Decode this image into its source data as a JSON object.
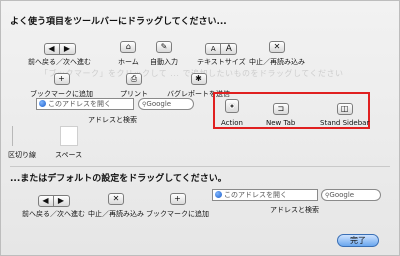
{
  "sheet": {
    "heading_top": "よく使う項目をツールバーにドラッグしてください...",
    "heading_bottom": "...またはデフォルトの設定をドラッグしてください。",
    "ghost_text": "「ブックマーク」をクリックして ... で追加したいものをドラッグしてください",
    "done_label": "完了"
  },
  "items": {
    "back_forward": "前へ戻る／次へ進む",
    "home": "ホーム",
    "autofill": "自動入力",
    "text_size": "テキストサイズ",
    "stop_reload": "中止／再読み込み",
    "add_bookmark": "ブックマークに追加",
    "print": "プリント",
    "bug_report": "バグレポートを送信",
    "address_search": "アドレスと検索",
    "action": "Action",
    "new_tab": "New Tab",
    "stand_sidebar": "Stand Sidebar",
    "separator": "区切り線",
    "space": "スペース"
  },
  "address_field": {
    "placeholder": "このアドレスを開く"
  },
  "search_field": {
    "placeholder": "Google"
  },
  "icons": {
    "back": "◀",
    "forward": "▶",
    "home": "⌂",
    "autofill": "✎",
    "text_small": "A",
    "text_large": "A",
    "stop": "✕",
    "add": "+",
    "print": "⎙",
    "bug": "✱",
    "tab": "⊐",
    "sidebar": "◫",
    "search": "🔍"
  },
  "default_set": {
    "back_forward": "前へ戻る／次へ進む",
    "stop_reload": "中止／再読み込み",
    "add_bookmark": "ブックマークに追加",
    "address_search": "アドレスと検索"
  },
  "colors": {
    "highlight": "#e02020",
    "done_button": "#6aa7ee"
  }
}
